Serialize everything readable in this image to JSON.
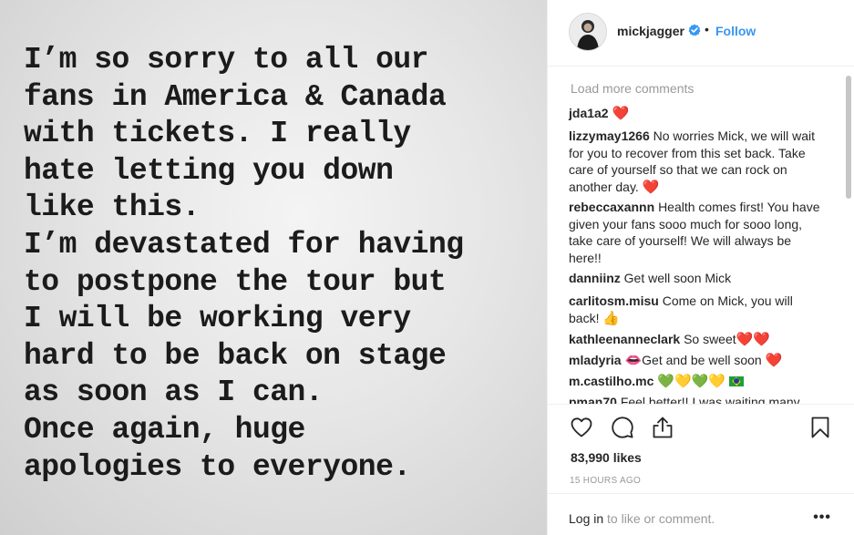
{
  "post": {
    "lines": [
      "I’m so sorry to all our",
      "fans in America & Canada",
      "with tickets. I really",
      "hate letting you down",
      "like this.",
      "I’m devastated for having",
      "to postpone the tour but",
      "I will be working very",
      "hard to be back on stage",
      "as soon as I can.",
      "Once again, huge",
      "apologies to everyone."
    ]
  },
  "header": {
    "username": "mickjagger",
    "separator": "•",
    "follow_label": "Follow"
  },
  "comments": {
    "load_more_label": "Load more comments",
    "items": [
      {
        "user": "jda1a2",
        "text": "",
        "emoji": "❤️"
      },
      {
        "user": "lizzymay1266",
        "text": "No worries Mick, we will wait for you to recover from this set back. Take care of yourself so that we can rock on another day.",
        "emoji": "❤️"
      },
      {
        "user": "rebeccaxannn",
        "text": "Health comes first! You have given your fans sooo much for sooo long, take care of yourself! We will always be here!!",
        "emoji": ""
      },
      {
        "user": "danniinz",
        "text": "Get well soon Mick",
        "emoji": ""
      },
      {
        "user": "carlitosm.misu",
        "text": "Come on Mick, you will back!",
        "emoji": "👍"
      },
      {
        "user": "kathleenanneclark",
        "text": "So sweet",
        "emoji": "❤️❤️"
      },
      {
        "user": "mladyria",
        "text": "Get and be well soon",
        "emoji_before": "👄",
        "emoji": "❤️"
      },
      {
        "user": "m.castilho.mc",
        "text": "",
        "emoji": "💚💛💚💛"
      },
      {
        "user": "pman70",
        "text": "Feel better!! I was waiting many",
        "emoji": ""
      }
    ]
  },
  "actions": {
    "likes": "83,990 likes",
    "timestamp": "15 HOURS AGO",
    "login_link": "Log in",
    "login_suffix": " to like or comment.",
    "more_label": "•••"
  },
  "colors": {
    "accent": "#3897f0",
    "text": "#262626",
    "muted": "#999999",
    "heart": "#e21f26"
  },
  "icons": [
    "verified-badge-icon",
    "heart-icon",
    "comment-icon",
    "share-icon",
    "bookmark-icon",
    "more-options-icon"
  ]
}
